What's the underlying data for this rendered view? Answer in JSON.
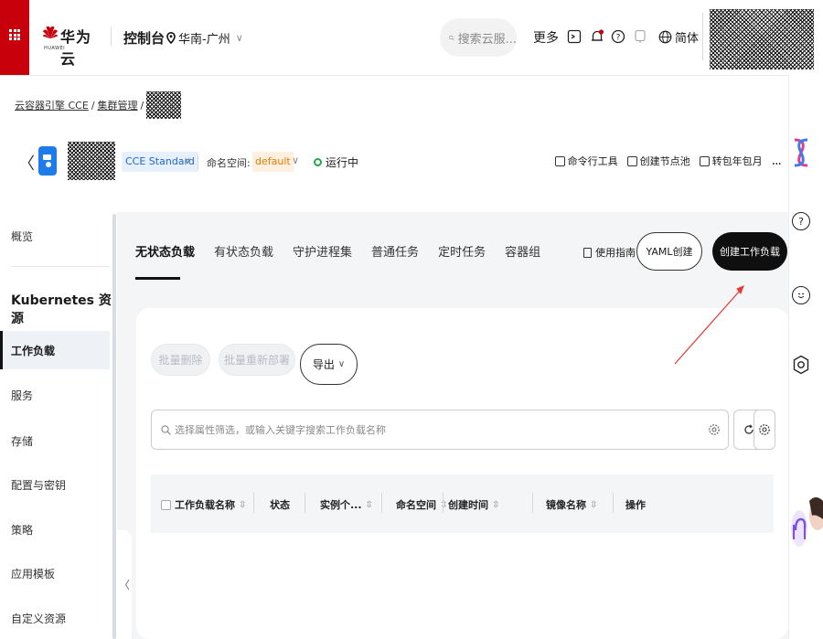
{
  "header": {
    "brand_cn": "华为云",
    "brand_en": "HUAWEI",
    "console": "控制台",
    "region": "华南-广州",
    "search_placeholder": "搜索云服...",
    "more": "更多",
    "language": "简体"
  },
  "breadcrumb": {
    "root": "云容器引擎 CCE",
    "section": "集群管理"
  },
  "cluster": {
    "version": "CCE Standard",
    "namespace_label": "命名空间:",
    "namespace": "default",
    "status": "运行中",
    "tools": [
      "命令行工具",
      "创建节点池",
      "转包年包月"
    ],
    "more": "..."
  },
  "sidebar": {
    "overview": "概览",
    "group": "Kubernetes 资源",
    "items": [
      "工作负载",
      "服务",
      "存储",
      "配置与密钥",
      "策略",
      "应用模板",
      "自定义资源"
    ]
  },
  "main": {
    "tabs": [
      "无状态负载",
      "有状态负载",
      "守护进程集",
      "普通任务",
      "定时任务",
      "容器组"
    ],
    "guide": "使用指南",
    "yaml_create": "YAML创建",
    "create_workload": "创建工作负载",
    "batch_delete": "批量删除",
    "batch_redeploy": "批量重新部署",
    "export": "导出",
    "filter_placeholder": "选择属性筛选，或输入关键字搜索工作负载名称",
    "columns": [
      "工作负载名称",
      "状态",
      "实例个...",
      "命名空间",
      "创建时间",
      "镜像名称",
      "操作"
    ]
  },
  "colors": {
    "brand_red": "#c7000b",
    "primary_button": "#0f0f0f",
    "namespace_tag": "#e57a00",
    "version_tag": "#1e66d0",
    "running": "#22a846",
    "annotation_arrow": "#e53935"
  },
  "icons": [
    "grid-icon",
    "huawei-logo-icon",
    "location-pin-icon",
    "search-icon",
    "terminal-icon",
    "bell-icon",
    "help-icon",
    "feedback-icon",
    "globe-icon",
    "back-chevron-icon",
    "cluster-icon",
    "guide-book-icon",
    "settings-icon",
    "refresh-icon",
    "checkbox-icon",
    "sort-icon"
  ]
}
